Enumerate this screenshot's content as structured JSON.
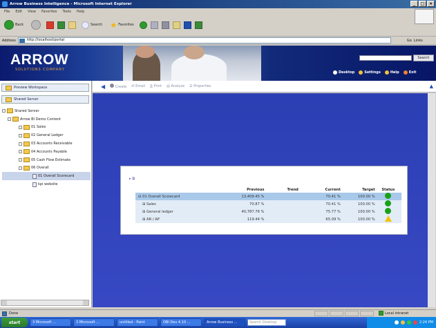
{
  "window": {
    "title": "Arrow Business Intelligence - Microsoft Internet Explorer",
    "buttons": [
      "_",
      "□",
      "×"
    ]
  },
  "menu": [
    "File",
    "Edit",
    "View",
    "Favorites",
    "Tools",
    "Help"
  ],
  "toolbar": {
    "back": "Back",
    "search": "Search",
    "favorites": "Favorites"
  },
  "address": {
    "label": "Address",
    "value": "http://localhost/portal",
    "go": "Go",
    "links": "Links"
  },
  "banner": {
    "logo": "ARROW",
    "tagline": "SOLUTIONS COMPANY",
    "search_button": "Search",
    "links": [
      "Desktop",
      "Settings",
      "Help",
      "Exit"
    ]
  },
  "sidebar": {
    "preview_workspace": "Preview Workspace",
    "shared_server": "Shared Server",
    "tree": [
      "Shared Server",
      "Arrow BI Demo Content",
      "01 Sales",
      "02 General Ledger",
      "03 Accounts Receivable",
      "04 Accounts Payable",
      "05 Cash Flow Estimate",
      "06 Overall",
      "01 Overall Scorecard",
      "kpi website"
    ]
  },
  "content_toolbar": {
    "create": "Create",
    "email": "Email",
    "print": "Print",
    "analyze": "Analyze",
    "properties": "Properties"
  },
  "scorecard": {
    "columns": [
      "Previous",
      "Trend",
      "Current",
      "Target",
      "Status"
    ],
    "rows": [
      {
        "name": "01 Overall Scorecard",
        "previous": "13,409.45 %",
        "trend": "",
        "current": "70.41 %",
        "target": "100.00 %",
        "status": "green"
      },
      {
        "name": "Sales",
        "previous": "70.87 %",
        "trend": "",
        "current": "70.41 %",
        "target": "100.00 %",
        "status": "green"
      },
      {
        "name": "General ledger",
        "previous": "40,787.76 %",
        "trend": "",
        "current": "75.77 %",
        "target": "100.00 %",
        "status": "green"
      },
      {
        "name": "AR / AP",
        "previous": "119.44 %",
        "trend": "",
        "current": "65.09 %",
        "target": "100.00 %",
        "status": "yellow"
      }
    ]
  },
  "statusbar": {
    "left": "Done",
    "zone": "Local intranet"
  },
  "taskbar": {
    "start": "start",
    "tasks": [
      "3 Microsoft ...",
      "3 Microsoft ...",
      "untitled - Paint",
      "OBI Dev 4.10 ...",
      "Arrow Business ..."
    ],
    "search": "Search Desktop",
    "time": "2:24 PM"
  },
  "colors": {
    "banner_dark": "#0b1a6e",
    "canvas": "#2b3fb3",
    "status_green": "#1aa11a",
    "status_yellow": "#f2c200",
    "row_highlight": "#a9c9ea"
  }
}
